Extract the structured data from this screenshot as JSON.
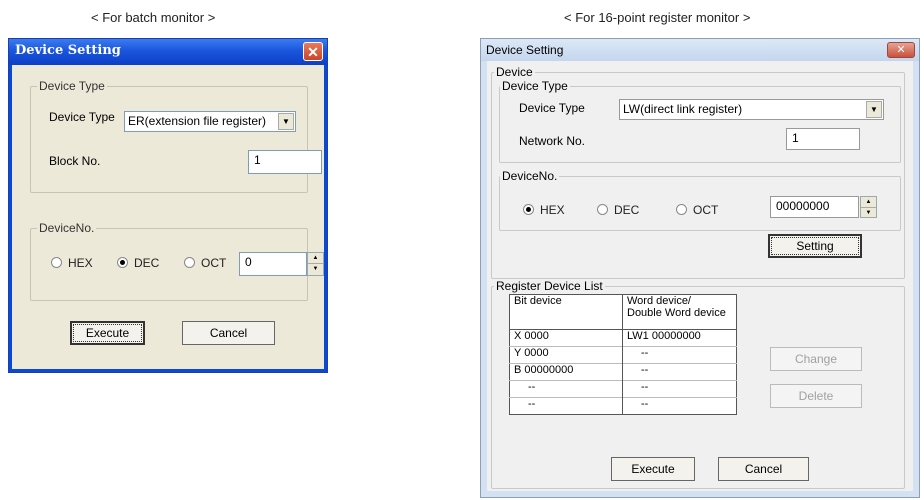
{
  "captions": {
    "left": "< For batch monitor >",
    "right": "< For 16-point register monitor >"
  },
  "batch_dialog": {
    "title": "Device Setting",
    "close_glyph": "✕",
    "device_type_group": "Device Type",
    "device_type_label": "Device Type",
    "device_type_value": "ER(extension file register)",
    "block_no_label": "Block No.",
    "block_no_value": "1",
    "device_no_group": "DeviceNo.",
    "radios": [
      {
        "label": "HEX",
        "selected": false
      },
      {
        "label": "DEC",
        "selected": true
      },
      {
        "label": "OCT",
        "selected": false
      }
    ],
    "device_no_value": "0",
    "execute_label": "Execute",
    "cancel_label": "Cancel"
  },
  "register_dialog": {
    "title": "Device Setting",
    "close_glyph": "✕",
    "device_group": "Device",
    "device_type_group": "Device Type",
    "device_type_label": "Device Type",
    "device_type_value": "LW(direct link register)",
    "network_no_label": "Network No.",
    "network_no_value": "1",
    "device_no_group": "DeviceNo.",
    "radios": [
      {
        "label": "HEX",
        "selected": true
      },
      {
        "label": "DEC",
        "selected": false
      },
      {
        "label": "OCT",
        "selected": false
      }
    ],
    "device_no_value": "00000000",
    "setting_label": "Setting",
    "register_list_group": "Register Device List",
    "table": {
      "header_bit": "Bit device",
      "header_word": "Word device/\nDouble Word device",
      "rows": [
        [
          "X 0000",
          "LW1 00000000"
        ],
        [
          "Y 0000",
          "--"
        ],
        [
          "B 00000000",
          "--"
        ],
        [
          "--",
          "--"
        ],
        [
          "--",
          "--"
        ]
      ]
    },
    "change_label": "Change",
    "delete_label": "Delete",
    "execute_label": "Execute",
    "cancel_label": "Cancel"
  }
}
